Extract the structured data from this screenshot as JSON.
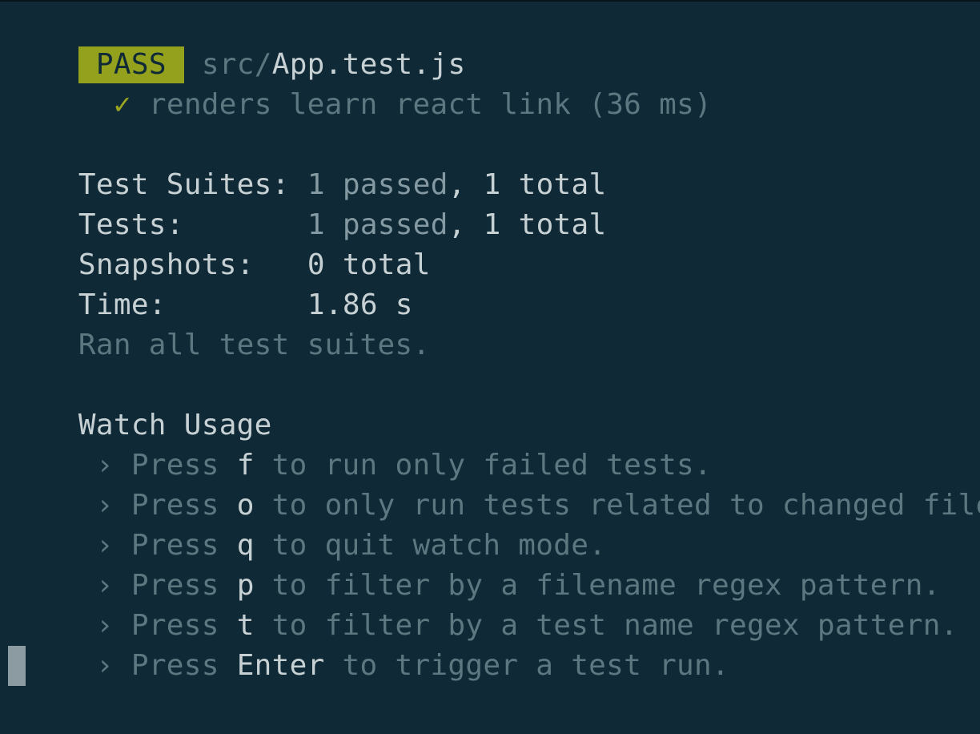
{
  "result": {
    "badge": "PASS",
    "file_dir": "src/",
    "file_name": "App.test.js",
    "check_mark": "✓",
    "test_name": "renders learn react link (36 ms)"
  },
  "summary": {
    "suites_label": "Test Suites:",
    "suites_passed": "1 passed",
    "suites_total": ", 1 total",
    "tests_label": "Tests:",
    "tests_passed": "1 passed",
    "tests_total": ", 1 total",
    "snapshots_label": "Snapshots:",
    "snapshots_value": "0 total",
    "time_label": "Time:",
    "time_value": "1.86 s",
    "ran_all": "Ran all test suites."
  },
  "watch_usage": {
    "title": "Watch Usage",
    "items": [
      {
        "prefix": "› Press ",
        "key": "f",
        "text": " to run only failed tests."
      },
      {
        "prefix": "› Press ",
        "key": "o",
        "text": " to only run tests related to changed files."
      },
      {
        "prefix": "› Press ",
        "key": "q",
        "text": " to quit watch mode."
      },
      {
        "prefix": "› Press ",
        "key": "p",
        "text": " to filter by a filename regex pattern."
      },
      {
        "prefix": "› Press ",
        "key": "t",
        "text": " to filter by a test name regex pattern."
      },
      {
        "prefix": "› Press ",
        "key": "Enter",
        "text": " to trigger a test run."
      }
    ]
  },
  "colors": {
    "background": "#0f2a36",
    "pass_badge": "#93a11d",
    "bright_text": "#c7d1d4",
    "dim_text": "#5d7781",
    "cursor": "#8c9ba1"
  }
}
